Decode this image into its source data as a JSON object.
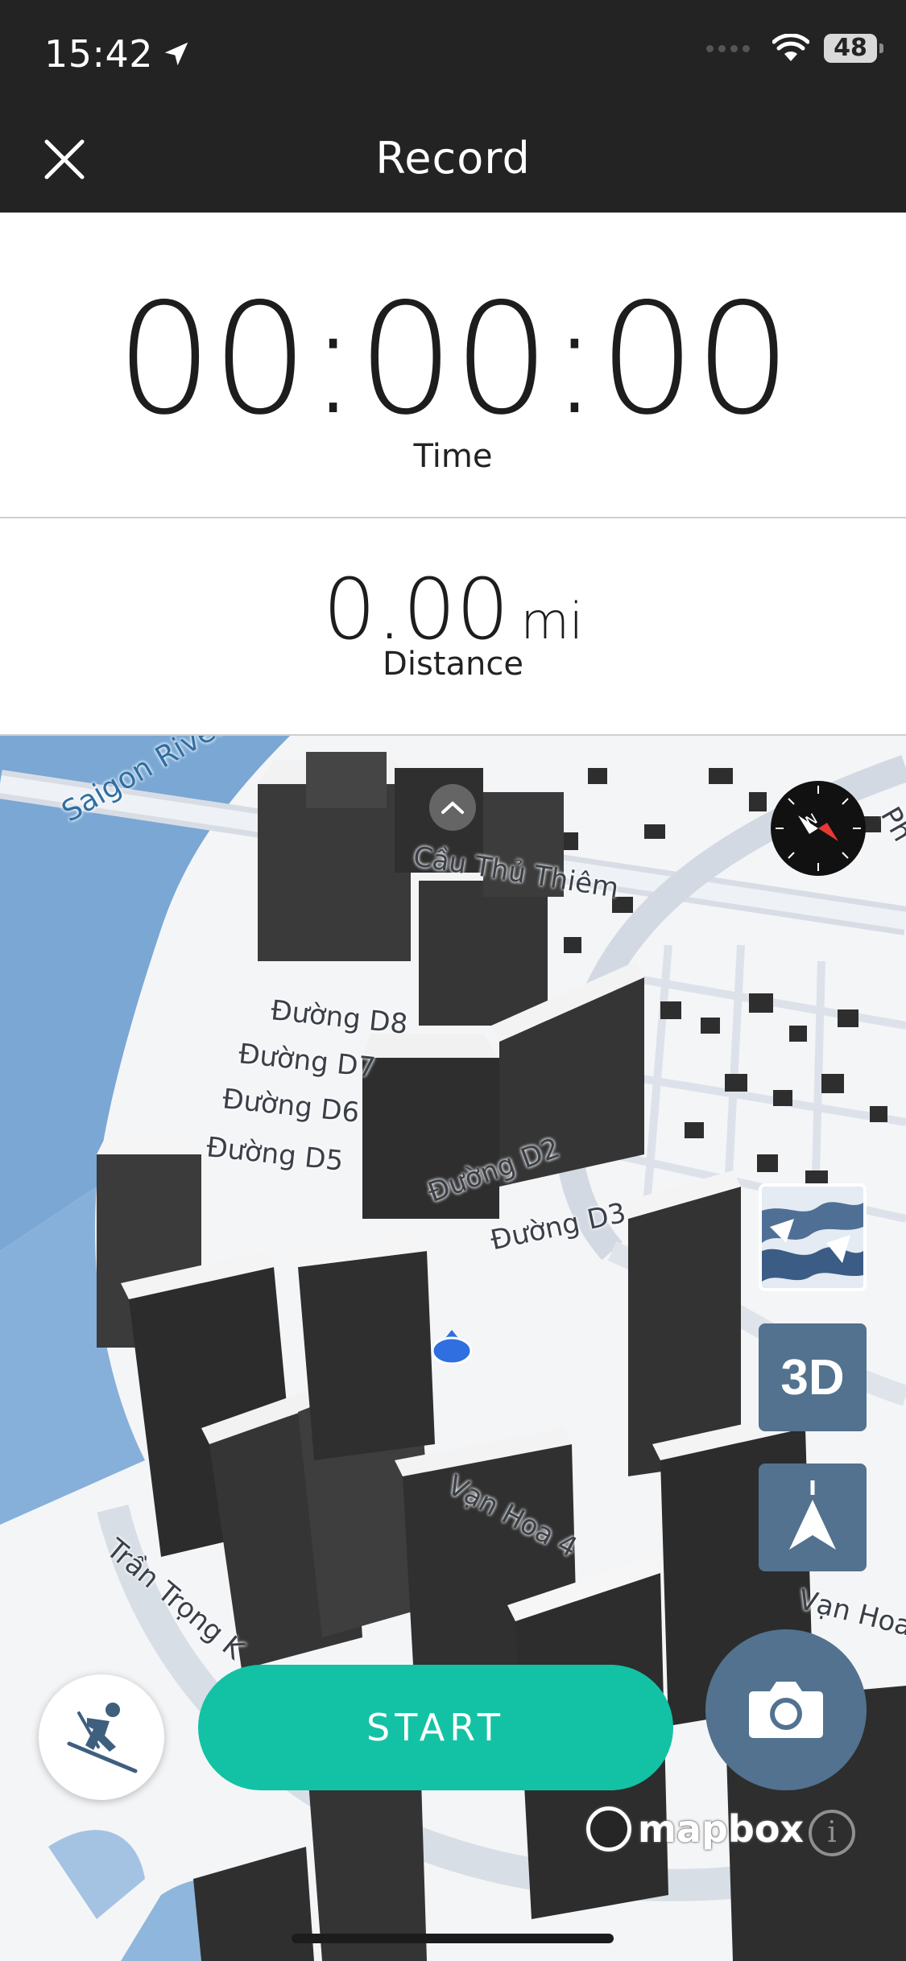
{
  "status_bar": {
    "time": "15:42",
    "battery": "48"
  },
  "nav": {
    "title": "Record"
  },
  "stats": {
    "time_value": "00:00:00",
    "time_label": "Time",
    "distance_value": "0.00",
    "distance_unit": "mi",
    "distance_label": "Distance"
  },
  "map": {
    "labels": {
      "river": "Saigon River",
      "bridge": "Cầu Thủ Thiêm",
      "d8": "Đường D8",
      "d7": "Đường D7",
      "d6": "Đường D6",
      "d5": "Đường D5",
      "d2": "Đường D2",
      "d3": "Đường D3",
      "vanhoa4": "Vạn Hoa 4",
      "vanhoa": "Vạn Hoa",
      "trantrong": "Trần Trọng K",
      "ph": "Ph"
    },
    "controls": {
      "btn_3d": "3D"
    },
    "attribution": {
      "logo_text": "mapbox",
      "info": "i"
    }
  },
  "actions": {
    "start_label": "START"
  },
  "colors": {
    "header_bg": "#232323",
    "start_button": "#13c2a5",
    "control_button": "#52728f",
    "water": "#7aa7d4",
    "building": "#3f3f3f"
  },
  "icons": {
    "close": "close-icon",
    "compass": "compass-icon",
    "activity": "skier-icon",
    "camera": "camera-icon",
    "north": "north-arrow-icon",
    "location": "location-arrow-icon"
  }
}
